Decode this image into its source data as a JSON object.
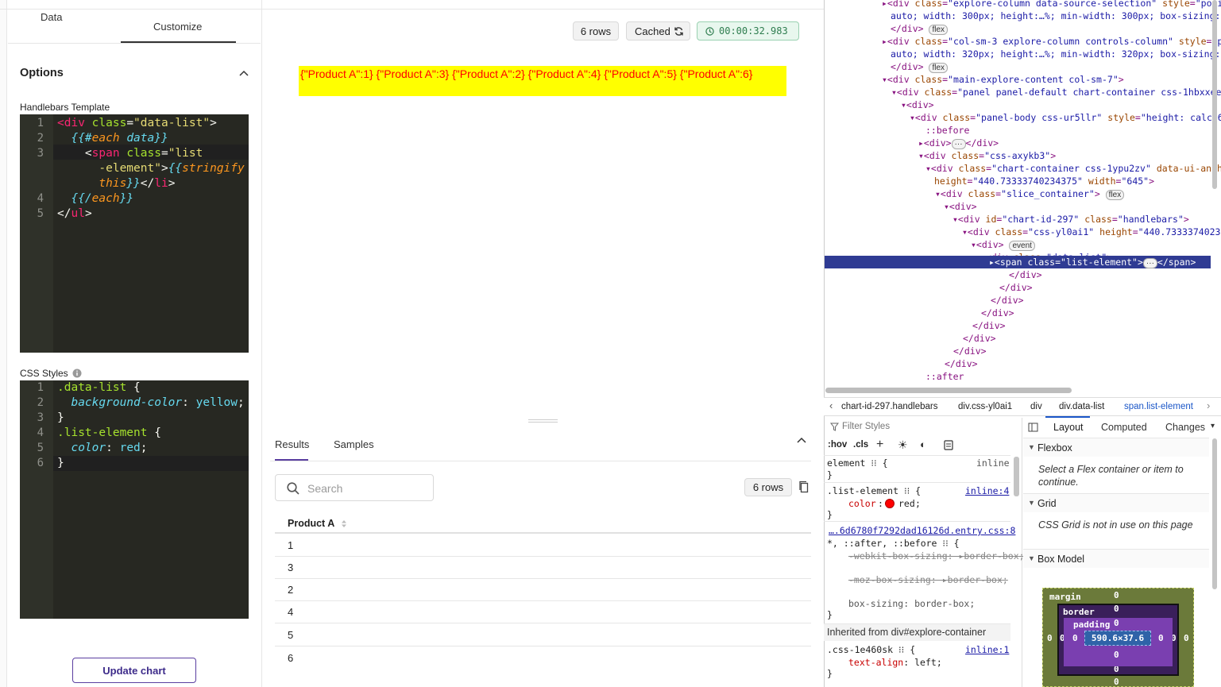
{
  "left_panel": {
    "tabs": [
      "Data",
      "Customize"
    ],
    "options_label": "Options",
    "template_label": "Handlebars Template",
    "css_label": "CSS Styles",
    "template_line_numbers": [
      "1",
      "2",
      "3",
      "4",
      "5"
    ],
    "template_code": [
      "<div class=\"data-list\">",
      "  {{#each data}}",
      "    <span class=\"list",
      "      -element\">{{stringify",
      "      this}}</li>",
      "  {{/each}}",
      "</ul>"
    ],
    "css_line_numbers": [
      "1",
      "2",
      "3",
      "4",
      "5",
      "6"
    ],
    "css_code": [
      ".data-list {",
      "  background-color: yellow;",
      "}",
      ".list-element {",
      "  color: red;",
      "}"
    ],
    "update_button": "Update chart"
  },
  "chart_header": {
    "rows_pill": "6 rows",
    "cached_pill": "Cached",
    "timer": "00:00:32.983"
  },
  "chart_output": "{\"Product A\":1} {\"Product A\":3} {\"Product A\":2} {\"Product A\":4} {\"Product A\":5} {\"Product A\":6}",
  "results": {
    "tabs": [
      "Results",
      "Samples"
    ],
    "search_placeholder": "Search",
    "row_count": "6 rows",
    "column": "Product A",
    "rows": [
      "1",
      "3",
      "2",
      "4",
      "5",
      "6"
    ]
  },
  "devtools": {
    "breadcrumbs": [
      "chart-id-297.handlebars",
      "div.css-yl0ai1",
      "div",
      "div.data-list",
      "span.list-element"
    ],
    "filter_placeholder": "Filter Styles",
    "hov": ":hov",
    "cls": ".cls",
    "panel_tabs": [
      "Layout",
      "Computed",
      "Changes"
    ],
    "sections": {
      "flexbox": "Flexbox",
      "flexbox_desc": "Select a Flex container or item to continue.",
      "grid": "Grid",
      "grid_desc": "CSS Grid is not in use on this page",
      "box_model": "Box Model"
    },
    "inherited": "Inherited from div#explore-container",
    "box_model": {
      "margin": "margin",
      "border": "border",
      "padding": "padding",
      "content": "590.6×37.6",
      "zero": "0"
    },
    "rules": {
      "element": "element",
      "inline": "inline",
      "list_selector": ".list-element",
      "list_link": "inline:4",
      "color_prop": "color",
      "color_val": "red",
      "file_link": "….6d6780f7292dad16126d.entry.css:8",
      "universal": "*, ::after, ::before",
      "webkit_prop": "-webkit-box-sizing",
      "moz_prop": "-moz-box-sizing",
      "bs_val": "border-box",
      "box_sizing": "box-sizing",
      "css_selector": ".css-1e460sk",
      "css_link": "inline:1",
      "text_align": "text-align",
      "left": "left"
    }
  },
  "colors": {
    "highlight_yellow": "#ffff00",
    "output_red": "#ff0000",
    "dom_selection": "#2f3b93",
    "margin_box": "#6b7a3a",
    "border_box": "#3a1f5a",
    "padding_box": "#7a3fb0",
    "content_box": "#2f63a8"
  }
}
